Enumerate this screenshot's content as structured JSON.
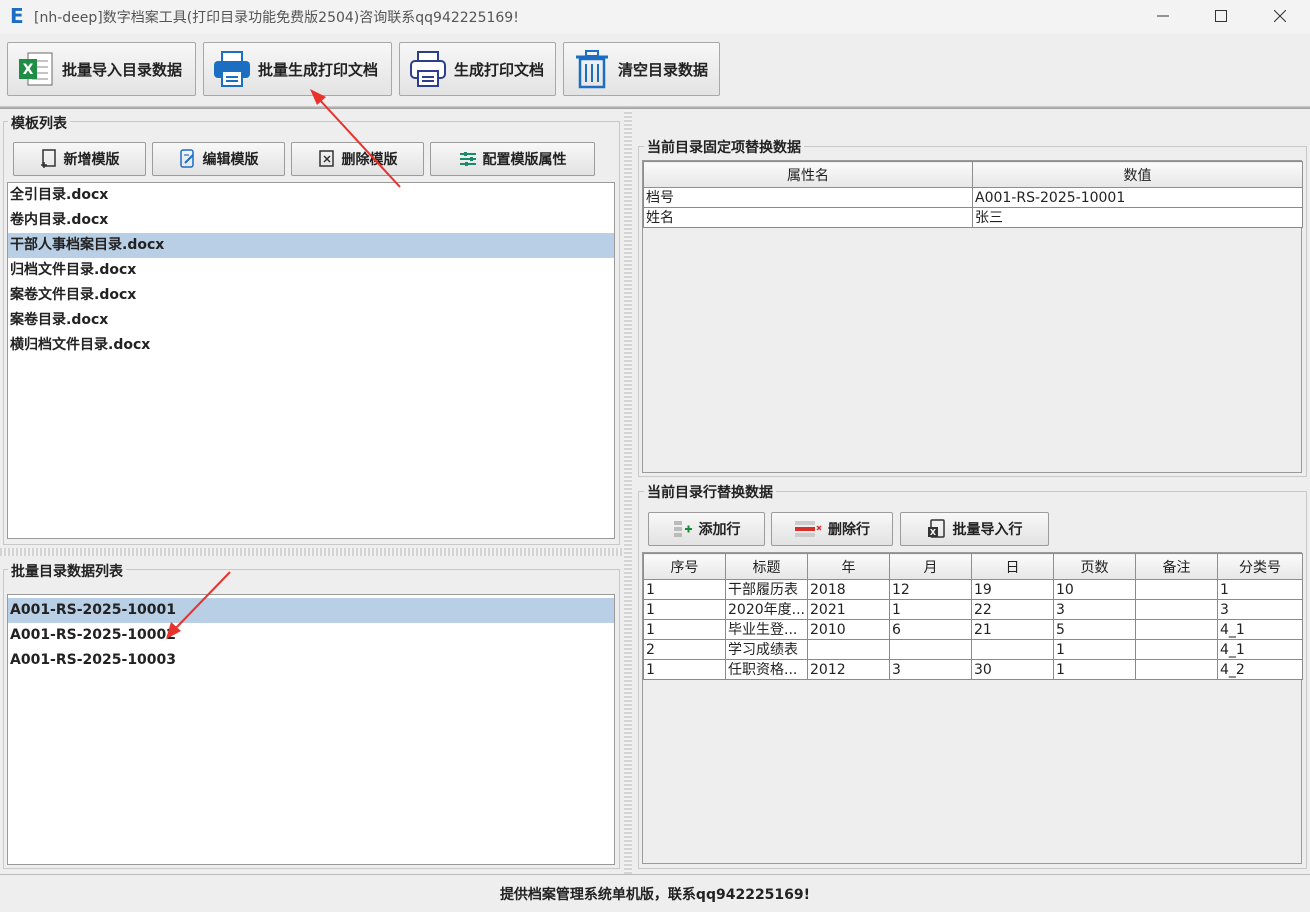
{
  "window": {
    "title": "[nh-deep]数字档案工具(打印目录功能免费版2504)咨询联系qq942225169!",
    "logo_letter": "E"
  },
  "toolbar": {
    "import_label": "批量导入目录数据",
    "batch_print_label": "批量生成打印文档",
    "print_label": "生成打印文档",
    "clear_label": "清空目录数据"
  },
  "templates": {
    "title": "模板列表",
    "add_label": "新增模版",
    "edit_label": "编辑模版",
    "delete_label": "删除模版",
    "config_label": "配置模版属性",
    "items": [
      {
        "name": "全引目录",
        "ext": ".docx"
      },
      {
        "name": "卷内目录",
        "ext": ".docx"
      },
      {
        "name": "干部人事档案目录",
        "ext": ".docx"
      },
      {
        "name": "归档文件目录",
        "ext": ".docx"
      },
      {
        "name": "案卷文件目录",
        "ext": ".docx"
      },
      {
        "name": "案卷目录",
        "ext": ".docx"
      },
      {
        "name": "横归档文件目录",
        "ext": ".docx"
      }
    ],
    "selected_index": 2
  },
  "batch_list": {
    "title": "批量目录数据列表",
    "items": [
      "A001-RS-2025-10001",
      "A001-RS-2025-10002",
      "A001-RS-2025-10003"
    ],
    "selected_index": 0
  },
  "fixed_data": {
    "title": "当前目录固定项替换数据",
    "headers": [
      "属性名",
      "数值"
    ],
    "rows": [
      [
        "档号",
        "A001-RS-2025-10001"
      ],
      [
        "姓名",
        "张三"
      ]
    ]
  },
  "row_data": {
    "title": "当前目录行替换数据",
    "add_label": "添加行",
    "delete_label": "删除行",
    "import_label": "批量导入行",
    "headers": [
      "序号",
      "标题",
      "年",
      "月",
      "日",
      "页数",
      "备注",
      "分类号"
    ],
    "rows": [
      [
        "1",
        "干部履历表",
        "2018",
        "12",
        "19",
        "10",
        "",
        "1"
      ],
      [
        "1",
        "2020年度...",
        "2021",
        "1",
        "22",
        "3",
        "",
        "3"
      ],
      [
        "1",
        "毕业生登...",
        "2010",
        "6",
        "21",
        "5",
        "",
        "4_1"
      ],
      [
        "2",
        "学习成绩表",
        "",
        "",
        "",
        "1",
        "",
        "4_1"
      ],
      [
        "1",
        "任职资格...",
        "2012",
        "3",
        "30",
        "1",
        "",
        "4_2"
      ]
    ]
  },
  "status": {
    "text": "提供档案管理系统单机版，联系qq942225169!"
  },
  "colors": {
    "accent_blue": "#1b6ec2",
    "selection": "#b8cfe5",
    "annotation_arrow": "#e8322b"
  },
  "icons": [
    "excel-icon",
    "printer-icon",
    "printer-outline-icon",
    "trash-icon",
    "add-file-icon",
    "edit-file-icon",
    "delete-file-icon",
    "config-icon",
    "add-row-icon",
    "delete-row-icon",
    "import-rows-icon"
  ]
}
